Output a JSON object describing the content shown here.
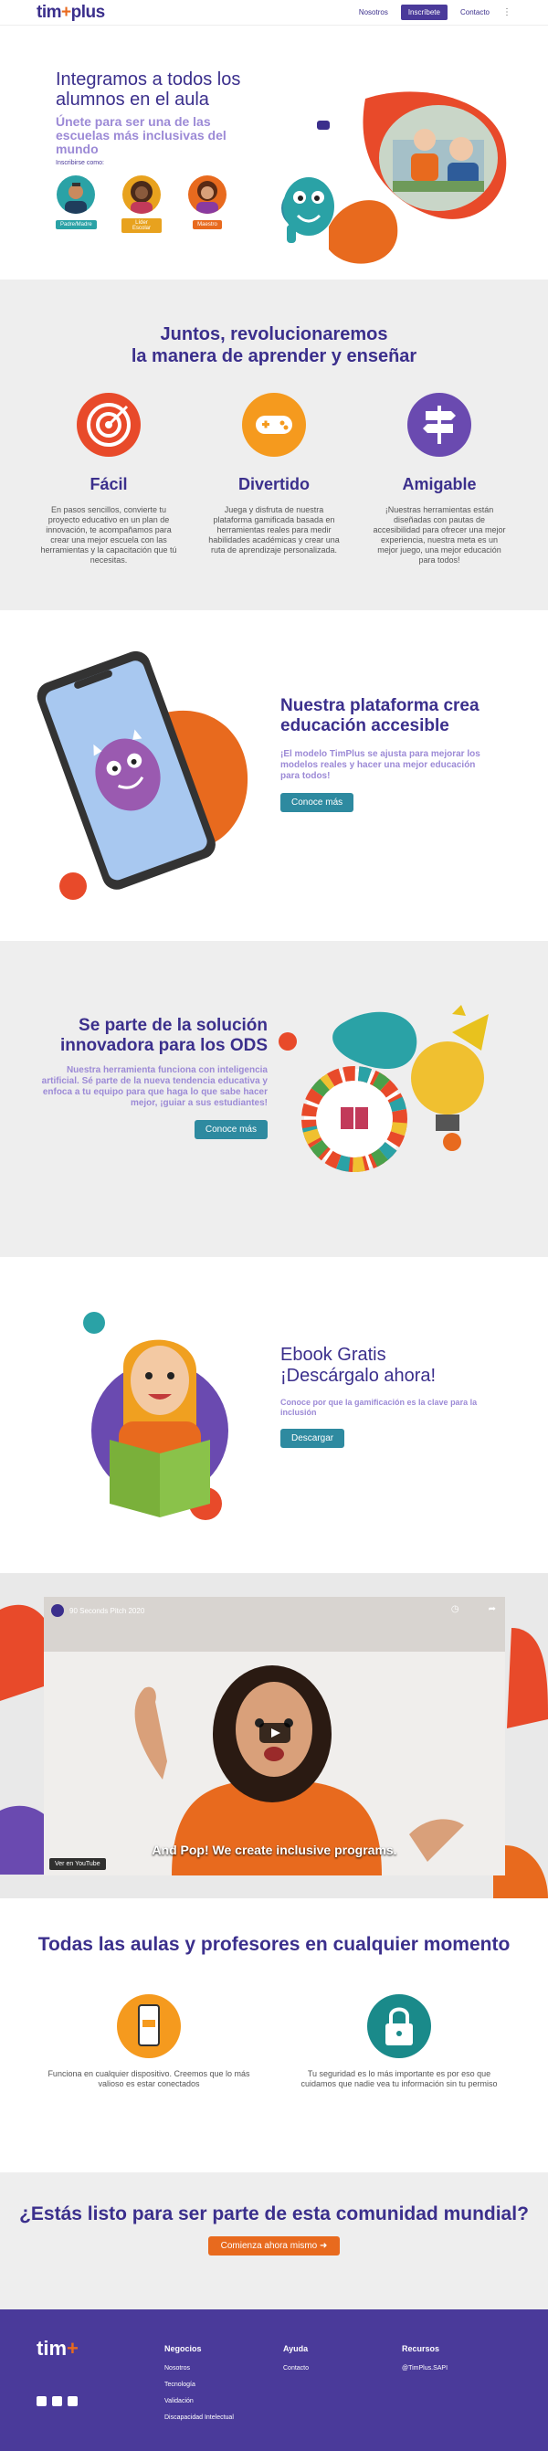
{
  "nav": {
    "logo": "tim+plus",
    "links": [
      "Nosotros",
      "Inscríbete",
      "Contacto"
    ]
  },
  "hero": {
    "title": "Integramos a todos los alumnos en el aula",
    "subtitle": "Únete para ser una de las escuelas más inclusivas del mundo",
    "register_as": "Inscribirse como:",
    "roles": [
      "Padre/Madre",
      "Líder Escolar",
      "Maestro"
    ]
  },
  "section2": {
    "title_line1": "Juntos, revolucionaremos",
    "title_line2": "la manera de aprender y enseñar",
    "features": [
      {
        "title": "Fácil",
        "text": "En pasos sencillos, convierte tu proyecto educativo en un plan de innovación, te acompañamos para crear una mejor escuela con las herramientas y la capacitación que tú necesitas."
      },
      {
        "title": "Divertido",
        "text": "Juega y disfruta de nuestra plataforma gamificada basada en herramientas reales para medir habilidades académicas y crear una ruta de aprendizaje personalizada."
      },
      {
        "title": "Amigable",
        "text": "¡Nuestras herramientas están diseñadas con pautas de accesibilidad para ofrecer una mejor experiencia, nuestra meta es un mejor juego, una mejor educación para todos!"
      }
    ]
  },
  "section3": {
    "title": "Nuestra plataforma crea educación accesible",
    "text": "¡El modelo TimPlus se ajusta para mejorar los modelos reales y hacer una mejor educación para todos!",
    "button": "Conoce más"
  },
  "section4": {
    "title": "Se parte de la solución innovadora para los ODS",
    "text": "Nuestra herramienta funciona con inteligencia artificial. Sé parte de la nueva tendencia educativa y enfoca a tu equipo para que haga lo que sabe hacer mejor, ¡guiar a sus estudiantes!",
    "button": "Conoce más"
  },
  "section5": {
    "title_line1": "Ebook Gratis",
    "title_line2": "¡Descárgalo ahora!",
    "text": "Conoce por que la gamificación es la clave para la inclusión",
    "button": "Descargar"
  },
  "video": {
    "title": "90 Seconds Pitch 2020",
    "caption": "And Pop! We create inclusive programs.",
    "watch_on": "Ver en",
    "platform": "YouTube"
  },
  "section7": {
    "title": "Todas las aulas y profesores en cualquier momento",
    "cols": [
      {
        "text": "Funciona en cualquier dispositivo. Creemos que lo más valioso es estar conectados"
      },
      {
        "text": "Tu seguridad es lo más importante es por eso que cuidamos que nadie vea tu información sin tu permiso"
      }
    ]
  },
  "section8": {
    "title": "¿Estás listo para ser parte de esta comunidad mundial?",
    "button": "Comienza ahora mismo ➜"
  },
  "footer": {
    "logo": "tim+",
    "col1": {
      "title": "Negocios",
      "items": [
        "Nosotros",
        "Tecnología",
        "Validación",
        "Discapacidad Intelectual"
      ]
    },
    "col2": {
      "title": "Ayuda",
      "items": [
        "Contacto"
      ]
    },
    "col3": {
      "title": "Recursos",
      "items": [
        "@TimPlus.SAPI"
      ]
    }
  },
  "colors": {
    "primary": "#3b2f8c",
    "accent": "#e86a1e",
    "teal": "#2e8aa0",
    "lilac": "#9c8ad6"
  }
}
